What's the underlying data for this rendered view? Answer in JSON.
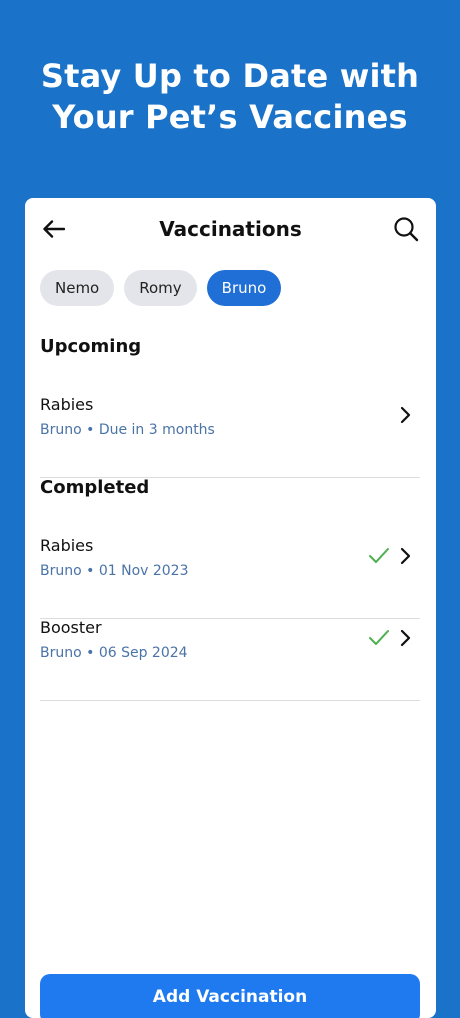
{
  "headline": {
    "line1": "Stay Up to Date with",
    "line2": "Your Pet’s Vaccines"
  },
  "app": {
    "title": "Vaccinations",
    "back_icon": "arrow-left-icon",
    "search_icon": "search-icon"
  },
  "pets": {
    "chips": [
      {
        "label": "Nemo",
        "selected": false
      },
      {
        "label": "Romy",
        "selected": false
      },
      {
        "label": "Bruno",
        "selected": true
      }
    ]
  },
  "upcoming": {
    "title": "Upcoming",
    "items": [
      {
        "name": "Rabies",
        "detail": "Bruno • Due in 3 months",
        "status_icon": "chevron-right-icon"
      }
    ]
  },
  "completed": {
    "title": "Completed",
    "items": [
      {
        "name": "Rabies",
        "detail": "Bruno • 01 Nov 2023",
        "status_icon": "check-icon"
      },
      {
        "name": "Booster",
        "detail": "Bruno • 06 Sep 2024",
        "status_icon": "check-icon"
      }
    ]
  },
  "footer": {
    "add_label": "Add Vaccination"
  },
  "colors": {
    "background": "#1a73c8",
    "accent": "#1f6fd6",
    "check": "#4caf50",
    "subtext": "#4a73a8"
  }
}
